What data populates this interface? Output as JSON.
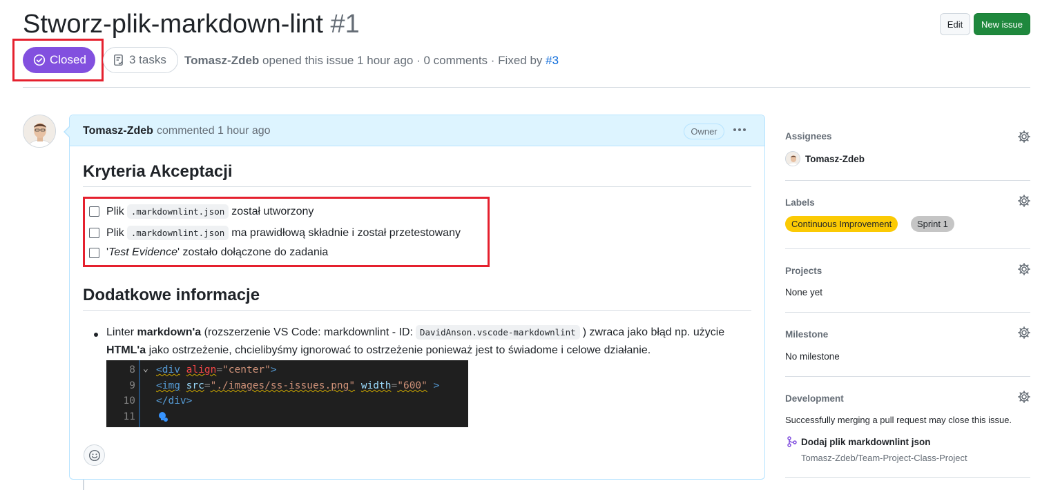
{
  "issue": {
    "title": "Stworz-plik-markdown-lint",
    "number": "#1",
    "state": "Closed",
    "tasks": "3 tasks",
    "author": "Tomasz-Zdeb",
    "meta_text": " opened this issue 1 hour ago · 0 comments · Fixed by ",
    "fixed_by": "#3"
  },
  "header_buttons": {
    "edit": "Edit",
    "new_issue": "New issue"
  },
  "comment": {
    "author": "Tomasz-Zdeb",
    "time": "commented 1 hour ago",
    "badge": "Owner",
    "heading1": "Kryteria Akceptacji",
    "tasks": [
      {
        "pre": "Plik",
        "code": ".markdownlint.json",
        "post": "został utworzony"
      },
      {
        "pre": "Plik",
        "code": ".markdownlint.json",
        "post": "ma prawidłową składnie i został przetestowany"
      },
      {
        "pre": "'",
        "em": "Test Evidence",
        "post": "' zostało dołączone do zadania"
      }
    ],
    "heading2": "Dodatkowe informacje",
    "bullet": {
      "t1": "Linter ",
      "b1": "markdown'a",
      "t2": " (rozszerzenie VS Code: markdownlint - ID:",
      "code": "DavidAnson.vscode-markdownlint",
      "t3": ") zwraca jako błąd np. użycie",
      "b2": "HTML'a",
      "t4": " jako ostrzeżenie, chcielibyśmy ignorować to ostrzeżenie ponieważ jest to świadome i celowe działanie."
    },
    "code_lines": [
      {
        "num": "8",
        "text": "<div align=\"center\">"
      },
      {
        "num": "9",
        "text": "<img src=\"./images/ss-issues.png\" width=\"600\" >"
      },
      {
        "num": "10",
        "text": "</div>"
      },
      {
        "num": "11",
        "text": ""
      }
    ]
  },
  "sidebar": {
    "assignees": {
      "heading": "Assignees",
      "user": "Tomasz-Zdeb"
    },
    "labels": {
      "heading": "Labels",
      "items": [
        {
          "name": "Continuous Improvement",
          "color": "#fbca04"
        },
        {
          "name": "Sprint 1",
          "color": "#c5c5c5"
        }
      ]
    },
    "projects": {
      "heading": "Projects",
      "value": "None yet"
    },
    "milestone": {
      "heading": "Milestone",
      "value": "No milestone"
    },
    "development": {
      "heading": "Development",
      "note": "Successfully merging a pull request may close this issue.",
      "pr_title": "Dodaj plik markdownlint json",
      "pr_repo": "Tomasz-Zdeb/Team-Project-Class-Project"
    }
  },
  "colors": {
    "closed": "#8250df",
    "new_issue": "#1f883d",
    "highlight": "#e5202e",
    "link": "#0969da"
  }
}
